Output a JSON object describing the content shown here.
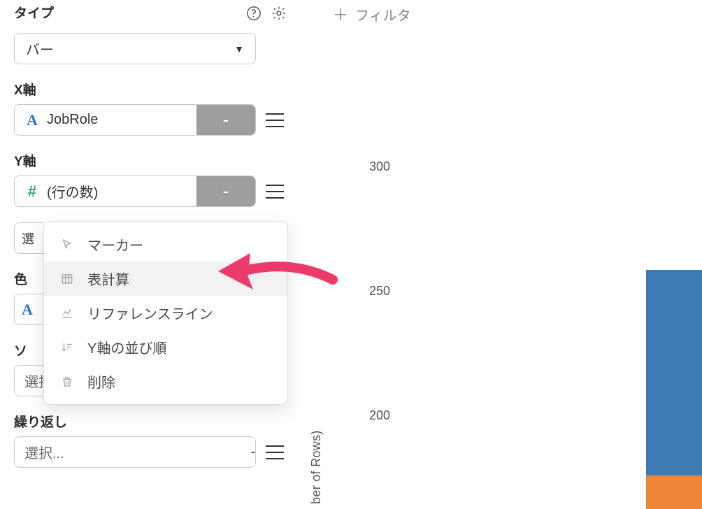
{
  "sidebar": {
    "type": {
      "label": "タイプ",
      "value": "バー"
    },
    "x": {
      "label": "X軸",
      "field": "JobRole",
      "suffix": "-"
    },
    "y": {
      "label": "Y軸",
      "field": "(行の数)",
      "suffix": "-"
    },
    "select_truncated": "選",
    "color_label_truncated": "色",
    "sort": {
      "label_truncated": "ソ",
      "placeholder": "選択...",
      "direction": "DESC"
    },
    "repeat": {
      "label": "繰り返し",
      "placeholder": "選択...",
      "suffix": "-"
    }
  },
  "menu": {
    "items": [
      {
        "key": "marker",
        "icon": "cursor-icon",
        "label": "マーカー"
      },
      {
        "key": "tablecalc",
        "icon": "table-icon",
        "label": "表計算",
        "hovered": true
      },
      {
        "key": "refline",
        "icon": "line-chart-icon",
        "label": "リファレンスライン"
      },
      {
        "key": "ysort",
        "icon": "sort-icon",
        "label": "Y軸の並び順"
      },
      {
        "key": "delete",
        "icon": "trash-icon",
        "label": "削除"
      }
    ]
  },
  "filter": {
    "add_label": "フィルタ"
  },
  "chart_data": {
    "type": "bar",
    "ylabel_visible_fragment": "ber of Rows)",
    "y_ticks_visible": [
      300,
      250,
      200
    ],
    "bars_partial": [
      {
        "color": "#3d79b3",
        "approx_value": 260
      },
      {
        "color": "#ef8637"
      }
    ]
  }
}
